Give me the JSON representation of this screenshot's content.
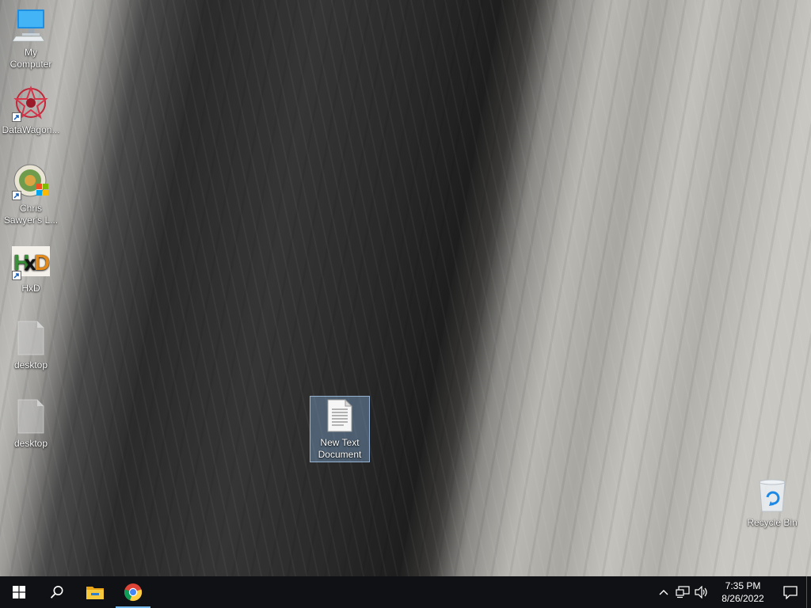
{
  "desktop": {
    "icons": [
      {
        "label": "My Computer",
        "icon": "computer-icon"
      },
      {
        "label": "DataWagon...",
        "icon": "datawagon-icon"
      },
      {
        "label": "Chris Sawyer's L...",
        "icon": "game-icon"
      },
      {
        "label": "HxD",
        "icon": "hex-editor-icon"
      },
      {
        "label": "desktop",
        "icon": "file-icon"
      },
      {
        "label": "desktop",
        "icon": "file-icon"
      },
      {
        "label": "New Text Document",
        "icon": "text-document-icon"
      },
      {
        "label": "Recycle Bin",
        "icon": "recycle-bin-icon"
      }
    ]
  },
  "taskbar": {
    "accent_color": "#76b9ed",
    "background_color": "#101114",
    "start": "windows-logo-icon",
    "search": "search-icon",
    "apps": [
      "file-explorer-icon",
      "chrome-icon"
    ],
    "tray_icons": [
      "chevron-up-icon",
      "network-icon",
      "volume-icon"
    ],
    "clock": {
      "time": "7:35 PM",
      "date": "8/26/2022"
    },
    "notification": "action-center-icon"
  }
}
